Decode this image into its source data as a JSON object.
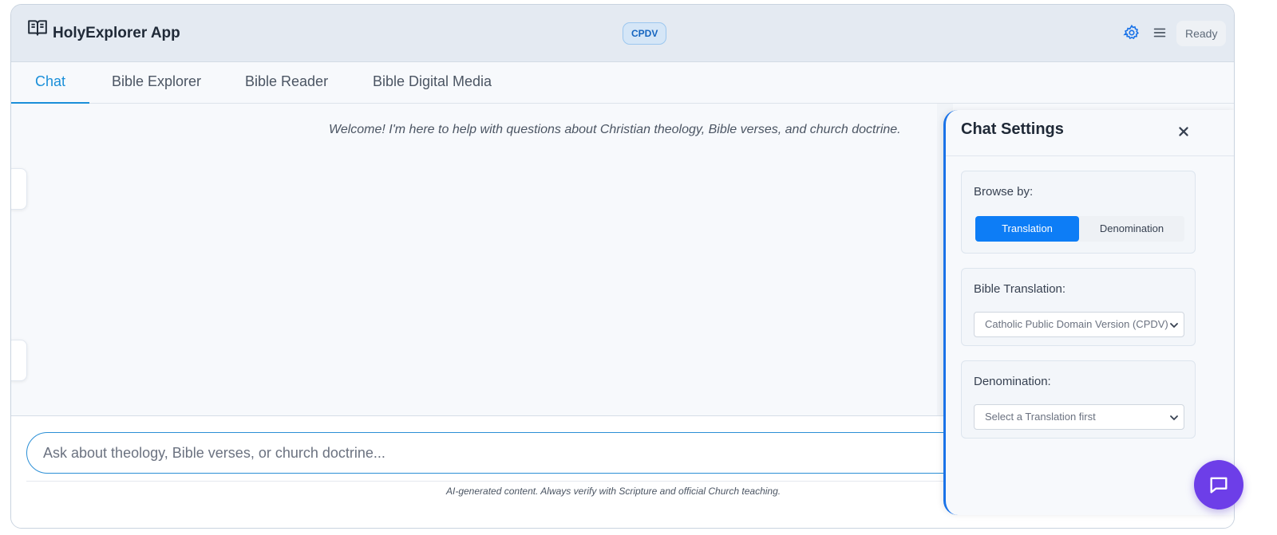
{
  "header": {
    "app_title": "HolyExplorer App",
    "translation_badge": "CPDV",
    "status": "Ready",
    "icons": [
      "open-book-icon",
      "gear-icon",
      "hamburger-menu-icon"
    ]
  },
  "tabs": [
    {
      "label": "Chat",
      "active": true
    },
    {
      "label": "Bible Explorer",
      "active": false
    },
    {
      "label": "Bible Reader",
      "active": false
    },
    {
      "label": "Bible Digital Media",
      "active": false
    }
  ],
  "chat": {
    "welcome": "Welcome! I'm here to help with questions about Christian theology, Bible verses, and church doctrine.",
    "input_placeholder": "Ask about theology, Bible verses, or church doctrine...",
    "disclaimer": "AI-generated content. Always verify with Scripture and official Church teaching."
  },
  "settings": {
    "title": "Chat Settings",
    "browse_by_label": "Browse by:",
    "browse_options": [
      "Translation",
      "Denomination"
    ],
    "browse_selected": "Translation",
    "translation_label": "Bible Translation:",
    "translation_value": "Catholic Public Domain Version (CPDV)",
    "denomination_label": "Denomination:",
    "denomination_value": "Select a Translation first"
  },
  "colors": {
    "accent": "#1a8fd9",
    "primary_button": "#0d7df6",
    "fab": "#6d3ee8",
    "badge_bg": "#d5e6f7"
  }
}
